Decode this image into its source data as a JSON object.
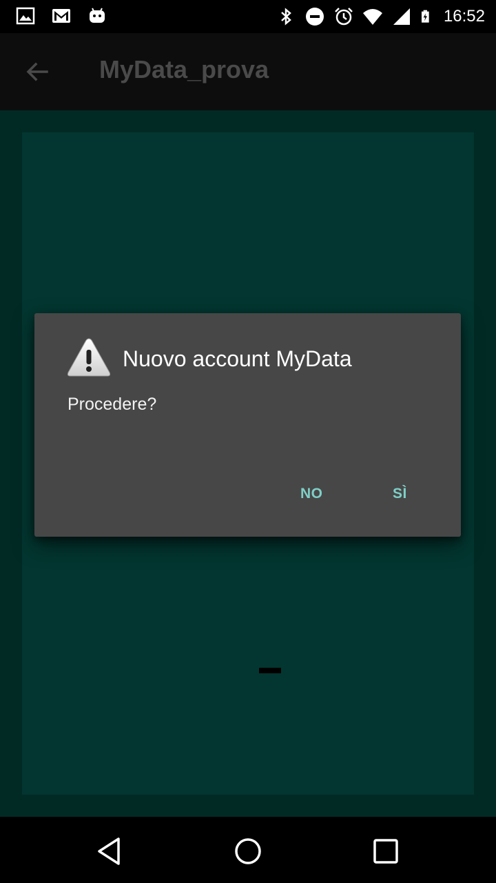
{
  "status_bar": {
    "time": "16:52",
    "left_icons": [
      "gallery-icon",
      "gmail-icon",
      "android-icon"
    ],
    "right_icons": [
      "bluetooth-icon",
      "do-not-disturb-icon",
      "alarm-icon",
      "wifi-icon",
      "signal-icon",
      "battery-charging-icon"
    ]
  },
  "app_bar": {
    "title": "MyData_prova",
    "back_icon": "arrow-back-icon"
  },
  "dialog": {
    "icon": "warning-icon",
    "title": "Nuovo account MyData",
    "message": "Procedere?",
    "negative_label": "NO",
    "positive_label": "SÌ"
  },
  "nav_bar": {
    "back_icon": "nav-back-icon",
    "home_icon": "nav-home-icon",
    "recents_icon": "nav-recents-icon"
  },
  "colors": {
    "content_bg": "#022a25",
    "card_bg": "#033630",
    "dialog_bg": "#474747",
    "button_text": "#7fcfc7"
  }
}
